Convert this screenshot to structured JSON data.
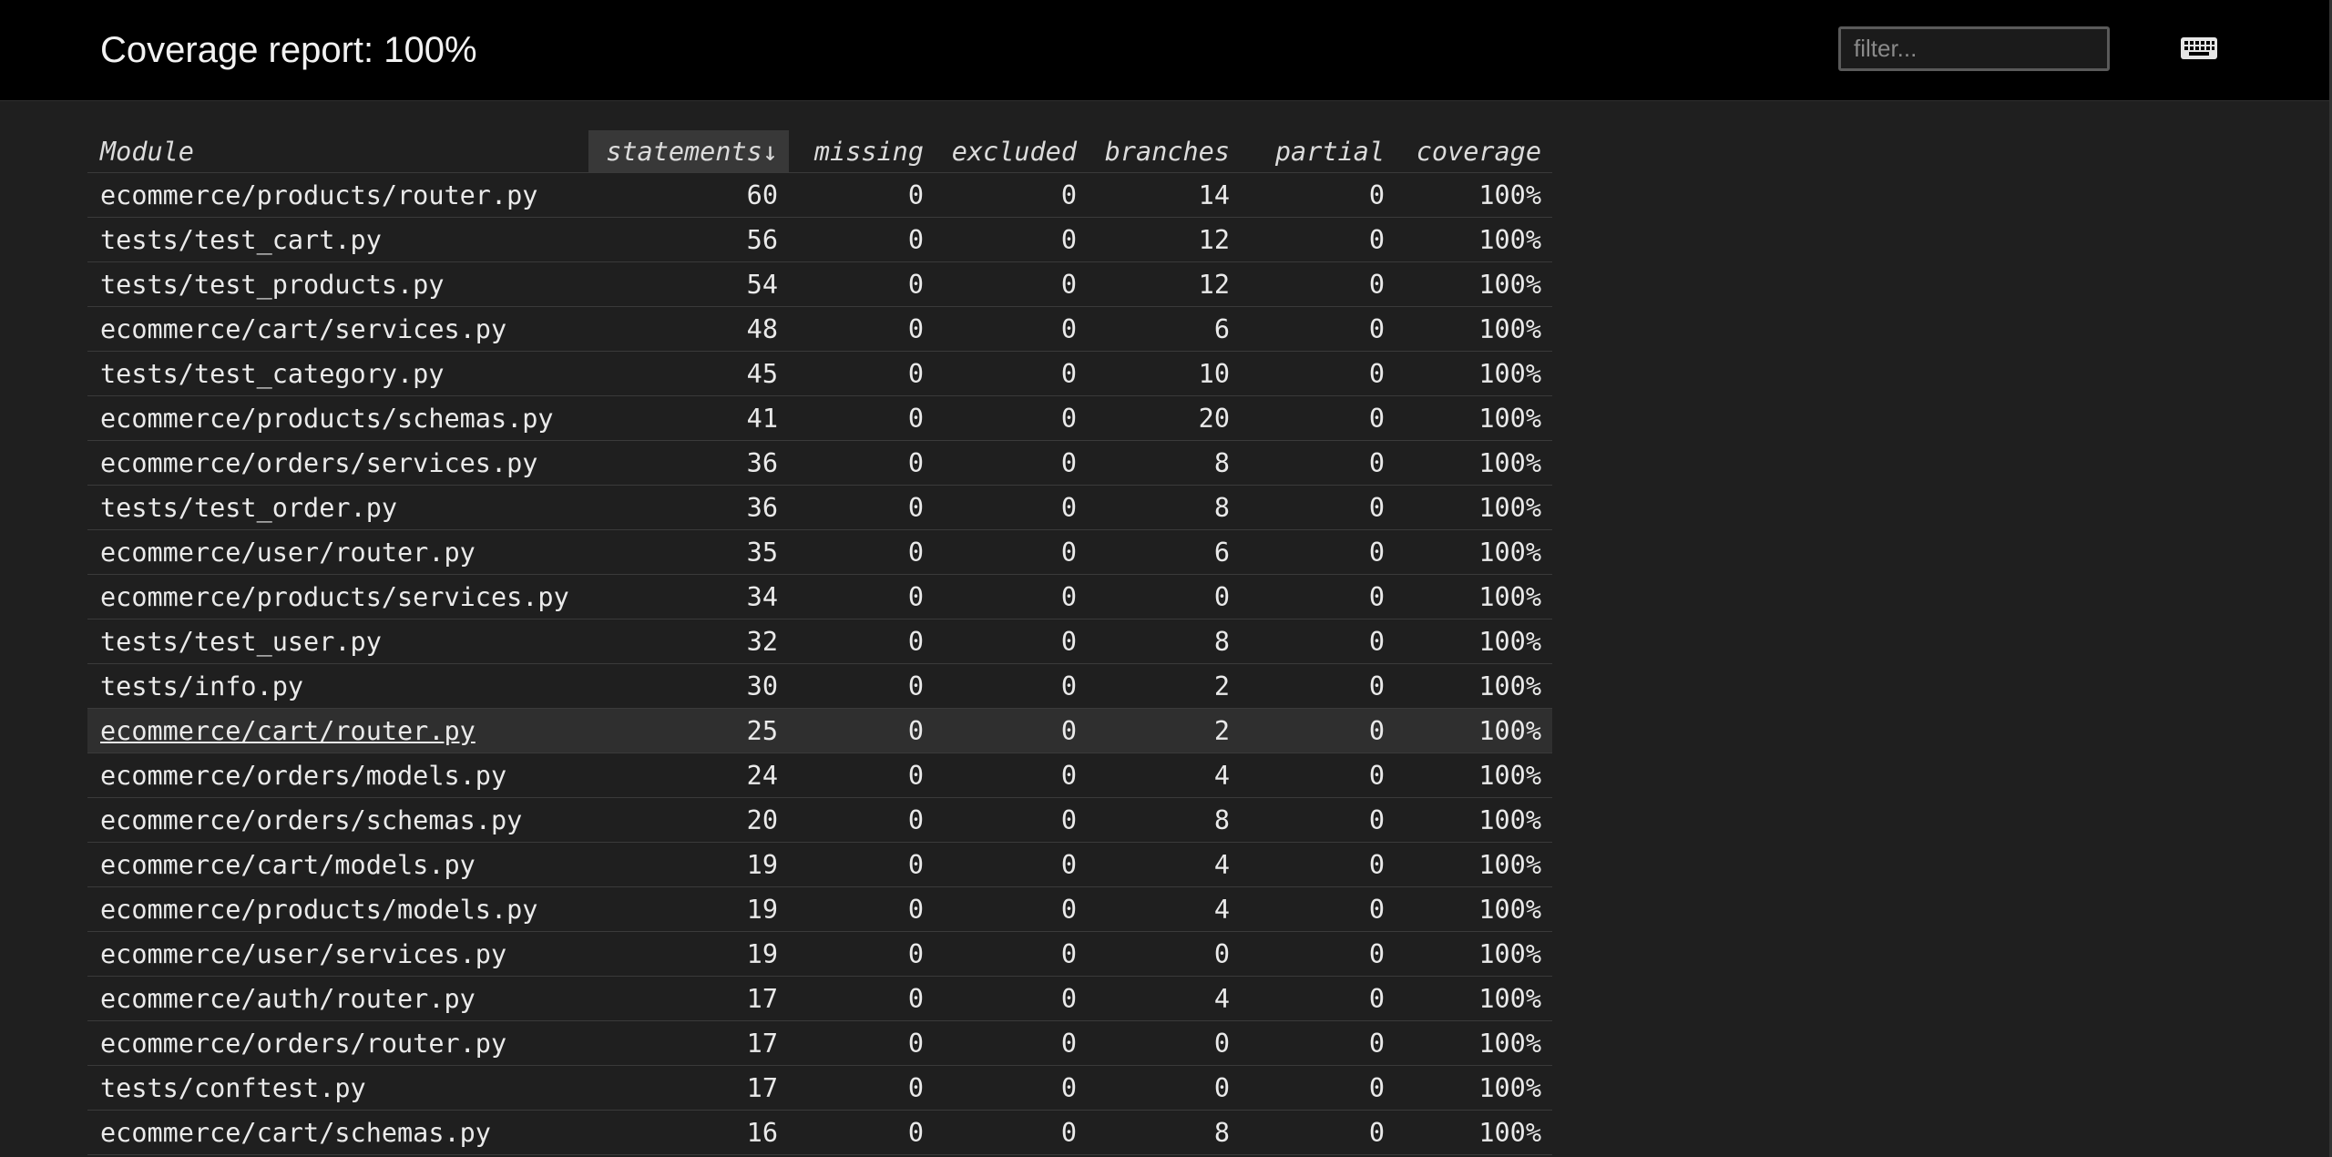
{
  "header": {
    "title": "Coverage report: 100%",
    "filter_placeholder": "filter...",
    "keyboard_icon": "keyboard-icon"
  },
  "table": {
    "columns": [
      "Module",
      "statements",
      "missing",
      "excluded",
      "branches",
      "partial",
      "coverage"
    ],
    "sort_indicator": "↓",
    "sorted_column": "statements",
    "highlighted_row": "ecommerce/cart/router.py",
    "rows": [
      [
        "ecommerce/products/router.py",
        "60",
        "0",
        "0",
        "14",
        "0",
        "100%"
      ],
      [
        "tests/test_cart.py",
        "56",
        "0",
        "0",
        "12",
        "0",
        "100%"
      ],
      [
        "tests/test_products.py",
        "54",
        "0",
        "0",
        "12",
        "0",
        "100%"
      ],
      [
        "ecommerce/cart/services.py",
        "48",
        "0",
        "0",
        "6",
        "0",
        "100%"
      ],
      [
        "tests/test_category.py",
        "45",
        "0",
        "0",
        "10",
        "0",
        "100%"
      ],
      [
        "ecommerce/products/schemas.py",
        "41",
        "0",
        "0",
        "20",
        "0",
        "100%"
      ],
      [
        "ecommerce/orders/services.py",
        "36",
        "0",
        "0",
        "8",
        "0",
        "100%"
      ],
      [
        "tests/test_order.py",
        "36",
        "0",
        "0",
        "8",
        "0",
        "100%"
      ],
      [
        "ecommerce/user/router.py",
        "35",
        "0",
        "0",
        "6",
        "0",
        "100%"
      ],
      [
        "ecommerce/products/services.py",
        "34",
        "0",
        "0",
        "0",
        "0",
        "100%"
      ],
      [
        "tests/test_user.py",
        "32",
        "0",
        "0",
        "8",
        "0",
        "100%"
      ],
      [
        "tests/info.py",
        "30",
        "0",
        "0",
        "2",
        "0",
        "100%"
      ],
      [
        "ecommerce/cart/router.py",
        "25",
        "0",
        "0",
        "2",
        "0",
        "100%"
      ],
      [
        "ecommerce/orders/models.py",
        "24",
        "0",
        "0",
        "4",
        "0",
        "100%"
      ],
      [
        "ecommerce/orders/schemas.py",
        "20",
        "0",
        "0",
        "8",
        "0",
        "100%"
      ],
      [
        "ecommerce/cart/models.py",
        "19",
        "0",
        "0",
        "4",
        "0",
        "100%"
      ],
      [
        "ecommerce/products/models.py",
        "19",
        "0",
        "0",
        "4",
        "0",
        "100%"
      ],
      [
        "ecommerce/user/services.py",
        "19",
        "0",
        "0",
        "0",
        "0",
        "100%"
      ],
      [
        "ecommerce/auth/router.py",
        "17",
        "0",
        "0",
        "4",
        "0",
        "100%"
      ],
      [
        "ecommerce/orders/router.py",
        "17",
        "0",
        "0",
        "0",
        "0",
        "100%"
      ],
      [
        "tests/conftest.py",
        "17",
        "0",
        "0",
        "0",
        "0",
        "100%"
      ],
      [
        "ecommerce/cart/schemas.py",
        "16",
        "0",
        "0",
        "8",
        "0",
        "100%"
      ]
    ]
  },
  "colors": {
    "header_bg": "#000000",
    "page_bg": "#1f1f1f",
    "text": "#eaeaea",
    "sorted_header_bg": "#383838",
    "highlight_row_bg": "#2f2f2f"
  }
}
